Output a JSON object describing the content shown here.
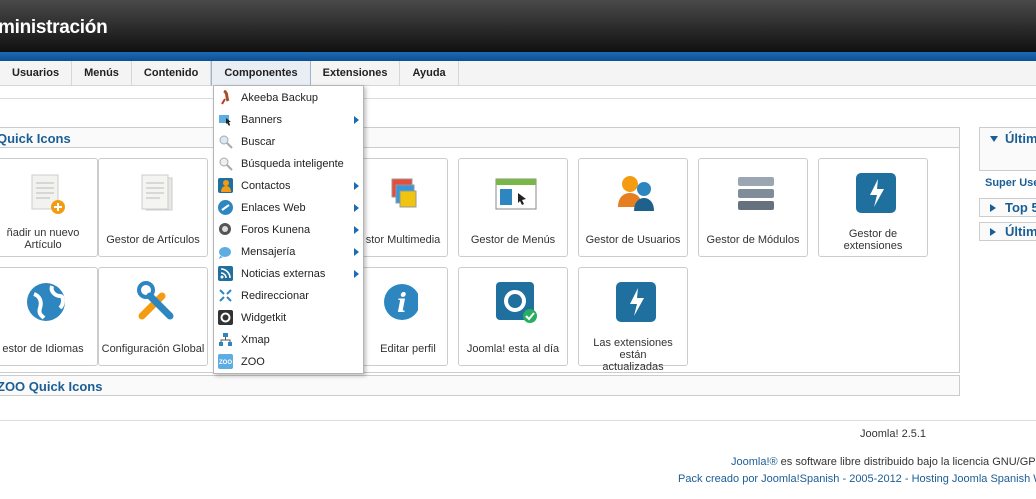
{
  "header": {
    "title": "ministración"
  },
  "menu": {
    "items": [
      "Usuarios",
      "Menús",
      "Contenido",
      "Componentes",
      "Extensiones",
      "Ayuda"
    ]
  },
  "quick_icons": {
    "title": "Quick Icons",
    "row1": [
      {
        "label": "ñadir un nuevo Artículo",
        "icon": "add-article-icon"
      },
      {
        "label": "Gestor de Artículos",
        "icon": "article-manager-icon"
      },
      {
        "label": "stor Multimedia",
        "icon": "media-manager-icon"
      },
      {
        "label": "Gestor de Menús",
        "icon": "menu-manager-icon"
      },
      {
        "label": "Gestor de Usuarios",
        "icon": "user-manager-icon"
      },
      {
        "label": "Gestor de Módulos",
        "icon": "module-manager-icon"
      },
      {
        "label": "Gestor de extensiones",
        "icon": "extension-manager-icon"
      }
    ],
    "row2": [
      {
        "label": "estor de Idiomas",
        "icon": "language-globe-icon"
      },
      {
        "label": "Configuración Global",
        "icon": "config-tools-icon"
      },
      {
        "label": "Editar perfil",
        "icon": "info-icon"
      },
      {
        "label": "Joomla! esta al día",
        "icon": "joomla-ok-icon"
      },
      {
        "label": "Las extensiones están actualizadas",
        "icon": "extensions-updated-icon"
      }
    ]
  },
  "zoo": {
    "title": "ZOO Quick Icons"
  },
  "right_panel": {
    "box1": "Últim",
    "super_user": "Super Use",
    "box2": "Top 5",
    "box3": "Últim"
  },
  "dropdown": {
    "items": [
      {
        "label": "Akeeba Backup",
        "submenu": false
      },
      {
        "label": "Banners",
        "submenu": true
      },
      {
        "label": "Buscar",
        "submenu": false
      },
      {
        "label": "Búsqueda inteligente",
        "submenu": false
      },
      {
        "label": "Contactos",
        "submenu": true
      },
      {
        "label": "Enlaces Web",
        "submenu": true
      },
      {
        "label": "Foros Kunena",
        "submenu": true
      },
      {
        "label": "Mensajería",
        "submenu": true
      },
      {
        "label": "Noticias externas",
        "submenu": true
      },
      {
        "label": "Redireccionar",
        "submenu": false
      },
      {
        "label": "Widgetkit",
        "submenu": false
      },
      {
        "label": "Xmap",
        "submenu": false
      },
      {
        "label": "ZOO",
        "submenu": false
      }
    ]
  },
  "footer": {
    "version": "Joomla! 2.5.1",
    "license_link": "Joomla!®",
    "license_text": " es software libre distribuido bajo la licencia GNU/GPL",
    "pack": "Pack creado por Joomla!Spanish - 2005-2012 - Hosting Joomla Spanish W"
  },
  "colors": {
    "accent": "#1b5e96",
    "blue_bar": "#1a6bb8"
  }
}
